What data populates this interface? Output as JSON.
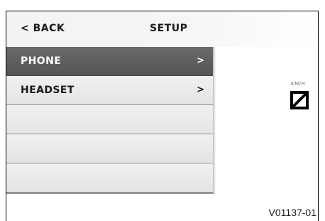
{
  "header": {
    "back_label": "< BACK",
    "title": "SETUP"
  },
  "menu": {
    "items": [
      {
        "label": "PHONE",
        "chevron": ">",
        "selected": true
      },
      {
        "label": "HEADSET",
        "chevron": ">",
        "selected": false
      },
      {
        "label": "",
        "chevron": "",
        "selected": false
      },
      {
        "label": "",
        "chevron": "",
        "selected": false
      },
      {
        "label": "",
        "chevron": "",
        "selected": false
      }
    ]
  },
  "speed": {
    "unit": "KM/H",
    "icon": "speed-blocked-icon"
  },
  "figure_code": "V01137-01",
  "colors": {
    "selected_bg": "#5f5f5f",
    "item_bg": "#e9e9e9",
    "text": "#1a1a1a"
  }
}
